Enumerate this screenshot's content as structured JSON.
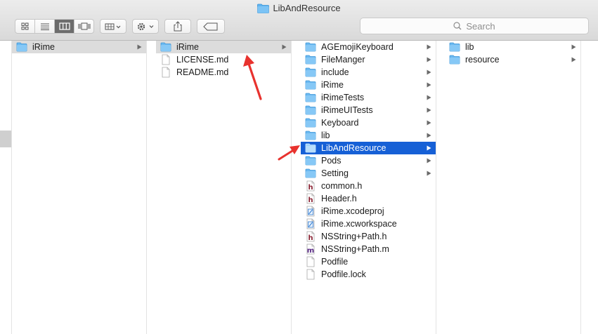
{
  "window": {
    "title": "LibAndResource"
  },
  "toolbar": {
    "search_placeholder": "Search",
    "view_modes": [
      "icon-view",
      "list-view",
      "column-view",
      "cover-flow-view"
    ],
    "active_view": "column-view"
  },
  "columns": [
    {
      "items": [
        {
          "label": "iRime",
          "type": "folder",
          "hasChildren": true,
          "state": "selected-inactive"
        }
      ]
    },
    {
      "items": [
        {
          "label": "iRime",
          "type": "folder",
          "hasChildren": true,
          "state": "selected-inactive"
        },
        {
          "label": "LICENSE.md",
          "type": "file"
        },
        {
          "label": "README.md",
          "type": "file"
        }
      ]
    },
    {
      "items": [
        {
          "label": "AGEmojiKeyboard",
          "type": "folder",
          "hasChildren": true
        },
        {
          "label": "FileManger",
          "type": "folder",
          "hasChildren": true
        },
        {
          "label": "include",
          "type": "folder",
          "hasChildren": true
        },
        {
          "label": "iRime",
          "type": "folder",
          "hasChildren": true
        },
        {
          "label": "iRimeTests",
          "type": "folder",
          "hasChildren": true
        },
        {
          "label": "iRimeUITests",
          "type": "folder",
          "hasChildren": true
        },
        {
          "label": "Keyboard",
          "type": "folder",
          "hasChildren": true
        },
        {
          "label": "lib",
          "type": "folder",
          "hasChildren": true
        },
        {
          "label": "LibAndResource",
          "type": "folder",
          "hasChildren": true,
          "state": "selected"
        },
        {
          "label": "Pods",
          "type": "folder",
          "hasChildren": true
        },
        {
          "label": "Setting",
          "type": "folder",
          "hasChildren": true
        },
        {
          "label": "common.h",
          "type": "header"
        },
        {
          "label": "Header.h",
          "type": "header"
        },
        {
          "label": "iRime.xcodeproj",
          "type": "xcodeproj"
        },
        {
          "label": "iRime.xcworkspace",
          "type": "xcworkspace"
        },
        {
          "label": "NSString+Path.h",
          "type": "header"
        },
        {
          "label": "NSString+Path.m",
          "type": "objc"
        },
        {
          "label": "Podfile",
          "type": "file"
        },
        {
          "label": "Podfile.lock",
          "type": "file"
        }
      ]
    },
    {
      "items": [
        {
          "label": "lib",
          "type": "folder",
          "hasChildren": true
        },
        {
          "label": "resource",
          "type": "folder",
          "hasChildren": true
        }
      ]
    }
  ],
  "colors": {
    "selection": "#1660d6",
    "inactive_selection": "#dcdcdc",
    "folder": "#5fb4f0",
    "annotation_arrow": "#e8322e"
  }
}
